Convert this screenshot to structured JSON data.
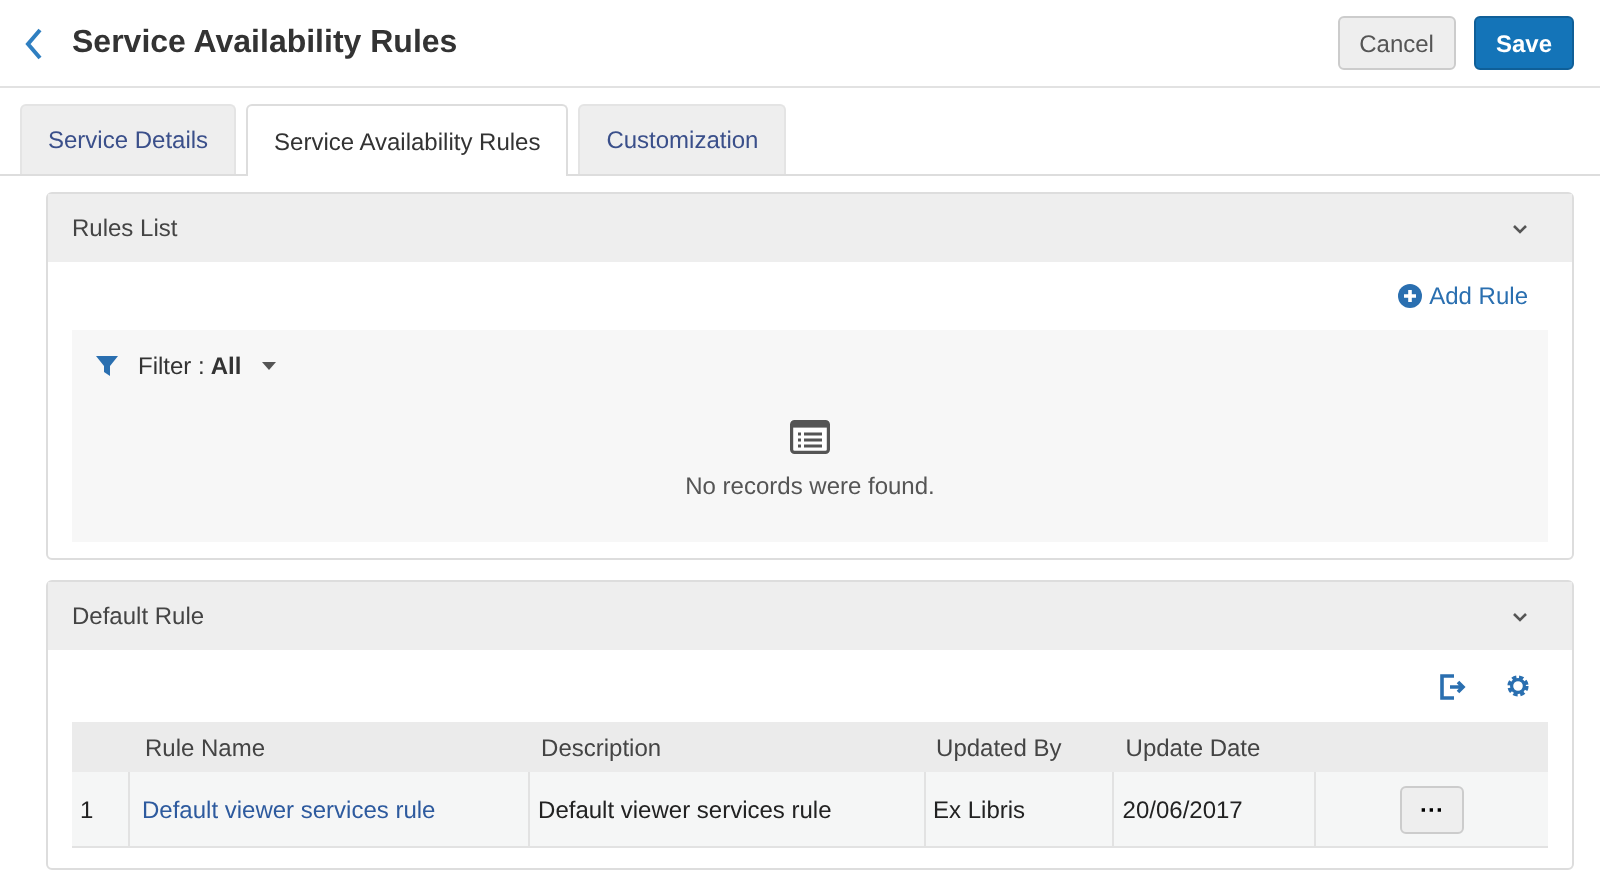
{
  "header": {
    "title": "Service Availability Rules",
    "buttons": [
      {
        "label": "Cancel",
        "kind": "secondary"
      },
      {
        "label": "Save",
        "kind": "primary"
      }
    ]
  },
  "tabs": [
    {
      "label": "Service Details",
      "selected": false
    },
    {
      "label": "Service Availability Rules",
      "selected": true
    },
    {
      "label": "Customization",
      "selected": false
    }
  ],
  "rules_list": {
    "title": "Rules List",
    "expanded": true,
    "add_label": "Add Rule",
    "filter_label": "Filter :",
    "filter_value": "All",
    "empty_message": "No records were found."
  },
  "default_rule": {
    "title": "Default Rule",
    "expanded": true,
    "table": {
      "columns": [
        "",
        "Rule Name",
        "Description",
        "Updated By",
        "Update Date",
        ""
      ],
      "rows": [
        {
          "index": "1",
          "name": "Default viewer services rule",
          "description": "Default viewer services rule",
          "updated_by": "Ex Libris",
          "update_date": "20/06/2017",
          "actions": "···"
        }
      ]
    }
  }
}
